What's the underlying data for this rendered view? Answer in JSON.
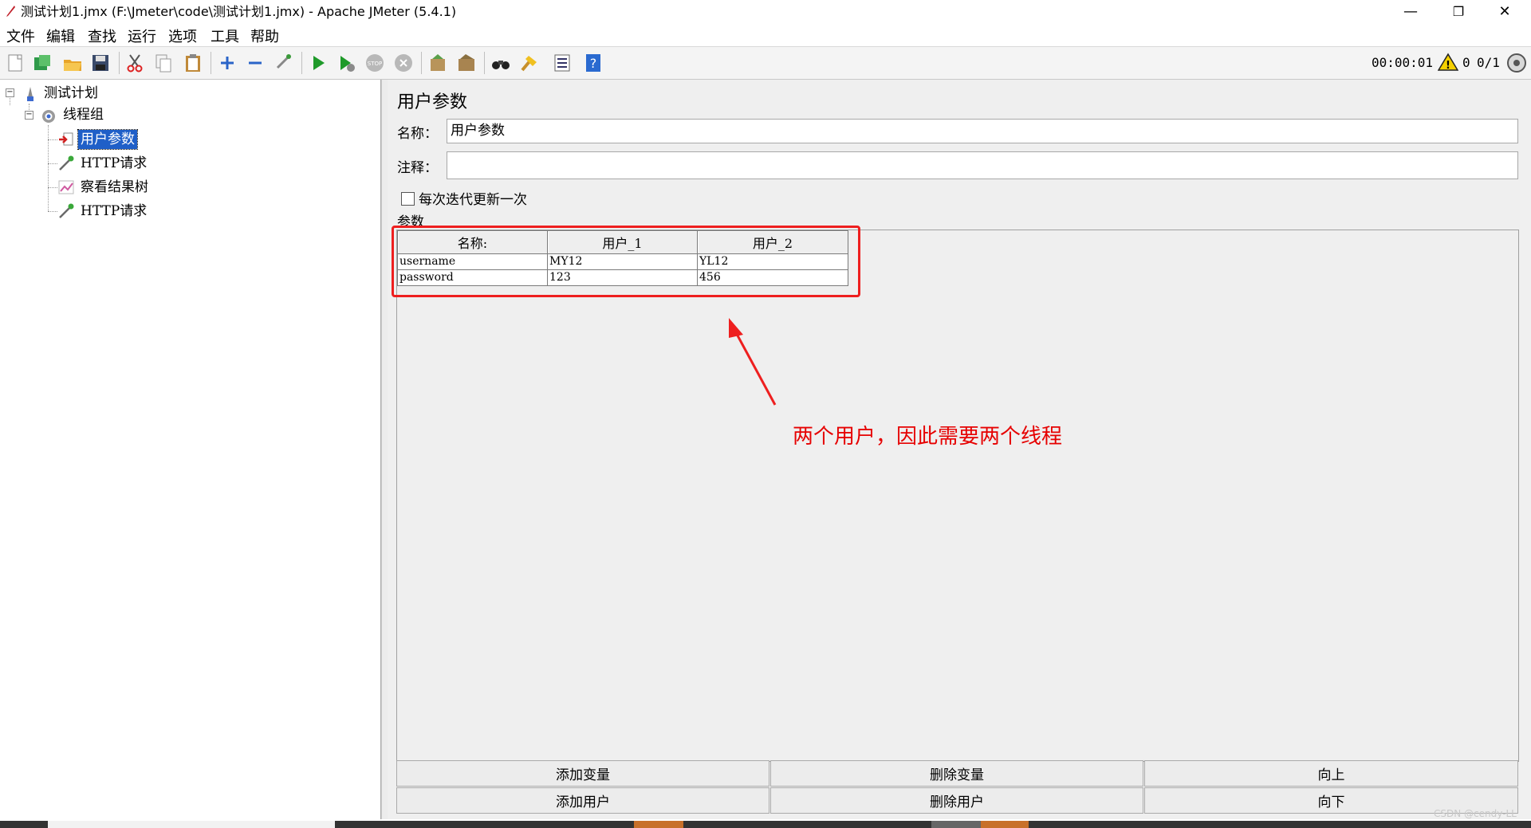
{
  "window": {
    "title": "测试计划1.jmx (F:\\Jmeter\\code\\测试计划1.jmx) - Apache JMeter (5.4.1)",
    "minimize": "—",
    "restore": "❐",
    "close": "✕"
  },
  "menu": [
    "文件",
    "编辑",
    "查找",
    "运行",
    "选项",
    "工具",
    "帮助"
  ],
  "toolbar": {
    "icons": [
      "new-icon",
      "templates-icon",
      "open-icon",
      "save-icon",
      "cut-icon",
      "copy-icon",
      "paste-icon",
      "expand-icon",
      "collapse-icon",
      "toggle-icon",
      "start-icon",
      "start-no-pause-icon",
      "stop-icon",
      "shutdown-icon",
      "clear-icon",
      "clear-all-icon",
      "search-icon",
      "reset-search-icon",
      "function-helper-icon",
      "help-icon"
    ],
    "timer": "00:00:01",
    "warning_count": "0",
    "threads": "0/1"
  },
  "tree": {
    "plan": "测试计划",
    "thread_group": "线程组",
    "items": [
      "用户参数",
      "HTTP请求",
      "察看结果树",
      "HTTP请求"
    ]
  },
  "panel": {
    "title": "用户参数",
    "name_label": "名称：",
    "name_value": "用户参数",
    "comment_label": "注释：",
    "comment_value": "",
    "checkbox_label": "每次迭代更新一次",
    "checkbox_checked": false,
    "params_label": "参数"
  },
  "table": {
    "headers": [
      "名称:",
      "用户_1",
      "用户_2"
    ],
    "rows": [
      [
        "username",
        "MY12",
        "YL12"
      ],
      [
        "password",
        "123",
        "456"
      ]
    ]
  },
  "buttons": {
    "add_variable": "添加变量",
    "delete_variable": "删除变量",
    "up": "向上",
    "add_user": "添加用户",
    "delete_user": "删除用户",
    "down": "向下"
  },
  "annotation": "两个用户，因此需要两个线程",
  "watermark": "CSDN @cendy-LL",
  "colors": {
    "highlight": "#ee1f1f",
    "annotation": "#e60000",
    "selection": "#1f5fc8"
  }
}
